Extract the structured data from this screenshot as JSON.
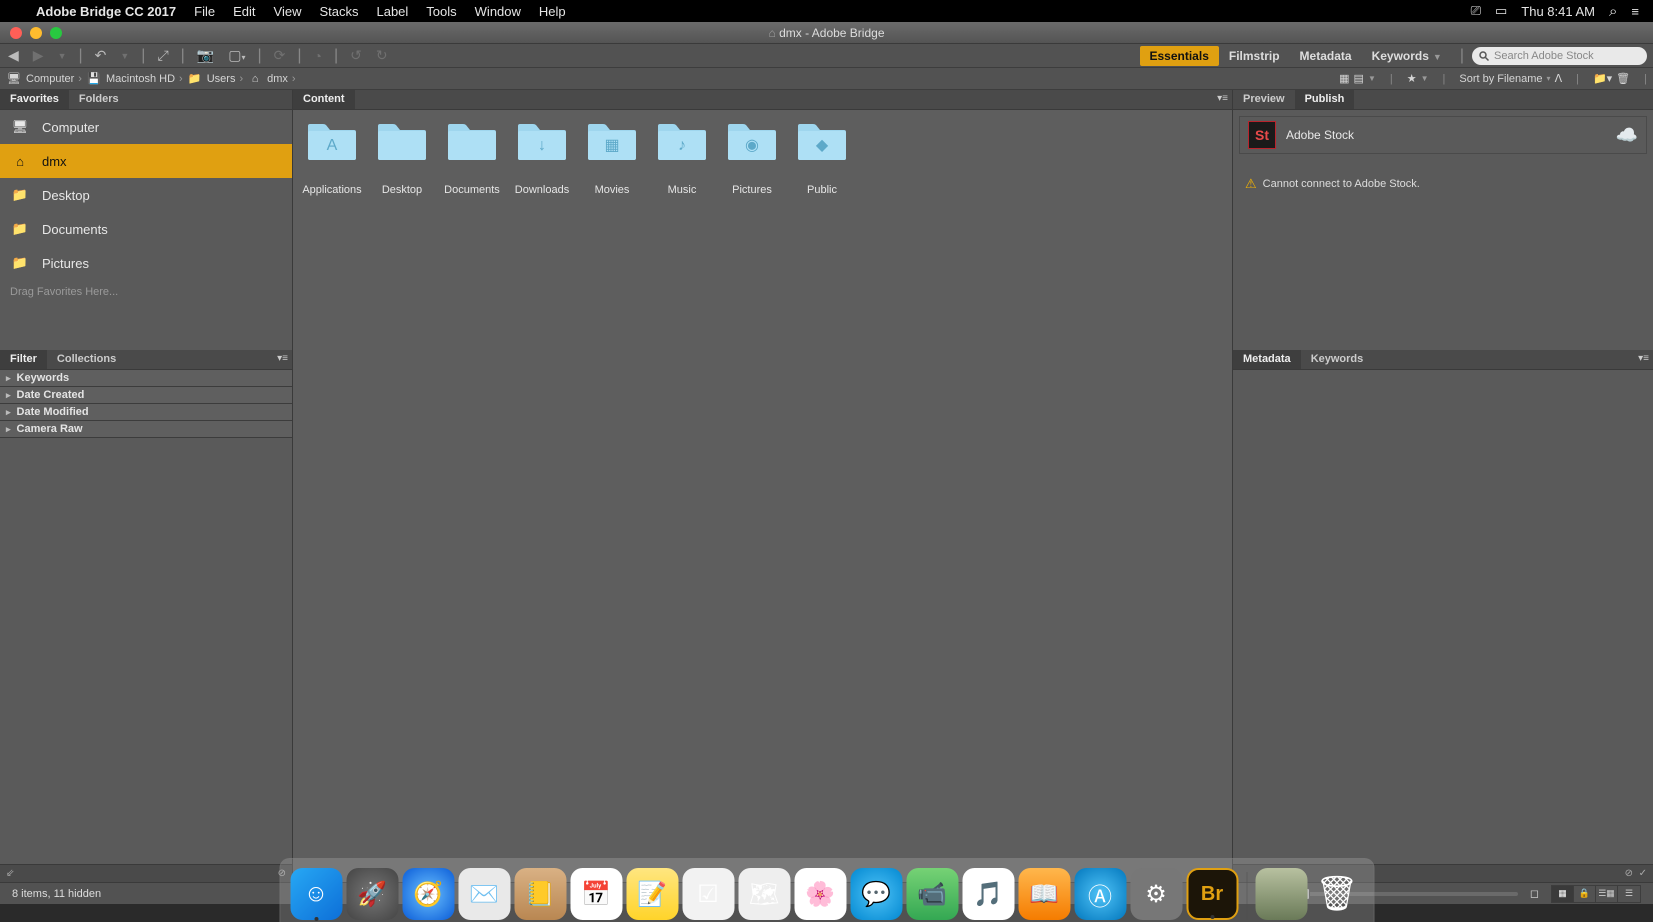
{
  "menubar": {
    "app_name": "Adobe Bridge CC 2017",
    "items": [
      "File",
      "Edit",
      "View",
      "Stacks",
      "Label",
      "Tools",
      "Window",
      "Help"
    ],
    "clock": "Thu 8:41 AM"
  },
  "window": {
    "title": "dmx - Adobe Bridge"
  },
  "workspaces": {
    "items": [
      "Essentials",
      "Filmstrip",
      "Metadata",
      "Keywords"
    ],
    "active": 0
  },
  "search": {
    "placeholder": "Search Adobe Stock"
  },
  "breadcrumbs": [
    {
      "label": "Computer",
      "icon": "monitor"
    },
    {
      "label": "Macintosh HD",
      "icon": "drive"
    },
    {
      "label": "Users",
      "icon": "folder"
    },
    {
      "label": "dmx",
      "icon": "home"
    }
  ],
  "sort": {
    "label": "Sort by Filename",
    "asc": true
  },
  "left": {
    "tabs_top": {
      "items": [
        "Favorites",
        "Folders"
      ],
      "active": 0
    },
    "favorites": [
      {
        "label": "Computer",
        "icon": "monitor",
        "selected": false
      },
      {
        "label": "dmx",
        "icon": "home",
        "selected": true
      },
      {
        "label": "Desktop",
        "icon": "folder",
        "selected": false
      },
      {
        "label": "Documents",
        "icon": "folder",
        "selected": false
      },
      {
        "label": "Pictures",
        "icon": "folder",
        "selected": false
      }
    ],
    "drag_hint": "Drag Favorites Here...",
    "tabs_bottom": {
      "items": [
        "Filter",
        "Collections"
      ],
      "active": 0
    },
    "filters": [
      "Keywords",
      "Date Created",
      "Date Modified",
      "Camera Raw"
    ]
  },
  "content": {
    "tab": "Content",
    "folders": [
      {
        "label": "Applications",
        "glyph": "A"
      },
      {
        "label": "Desktop",
        "glyph": ""
      },
      {
        "label": "Documents",
        "glyph": ""
      },
      {
        "label": "Downloads",
        "glyph": "↓"
      },
      {
        "label": "Movies",
        "glyph": "▦"
      },
      {
        "label": "Music",
        "glyph": "♪"
      },
      {
        "label": "Pictures",
        "glyph": "◉"
      },
      {
        "label": "Public",
        "glyph": "◆"
      }
    ]
  },
  "right": {
    "tabs_top": {
      "items": [
        "Preview",
        "Publish"
      ],
      "active": 1
    },
    "stock_label": "Adobe Stock",
    "stock_error": "Cannot connect to Adobe Stock.",
    "tabs_bottom": {
      "items": [
        "Metadata",
        "Keywords"
      ],
      "active": 0
    }
  },
  "status": {
    "text": "8 items, 11 hidden"
  },
  "dock": {
    "apps": [
      {
        "name": "finder",
        "bg": "linear-gradient(135deg,#27a8f4,#0d6fd8)",
        "glyph": "☺",
        "dot": true
      },
      {
        "name": "launchpad",
        "bg": "radial-gradient(circle,#777,#444)",
        "glyph": "🚀"
      },
      {
        "name": "safari",
        "bg": "radial-gradient(circle,#6cc2ff,#0a5cd8)",
        "glyph": "🧭"
      },
      {
        "name": "mail",
        "bg": "#e9e9e9",
        "glyph": "✉️"
      },
      {
        "name": "contacts",
        "bg": "linear-gradient(#d9b184,#b98752)",
        "glyph": "📒"
      },
      {
        "name": "calendar",
        "bg": "#fff",
        "glyph": "📅"
      },
      {
        "name": "notes",
        "bg": "linear-gradient(#ffe680,#ffd42a)",
        "glyph": "📝"
      },
      {
        "name": "reminders",
        "bg": "#f2f2f2",
        "glyph": "☑"
      },
      {
        "name": "maps",
        "bg": "#eee",
        "glyph": "🗺"
      },
      {
        "name": "photos",
        "bg": "#fff",
        "glyph": "🌸"
      },
      {
        "name": "messages",
        "bg": "radial-gradient(circle,#4fc3f7,#0288d1)",
        "glyph": "💬"
      },
      {
        "name": "facetime",
        "bg": "linear-gradient(#76d275,#34a853)",
        "glyph": "📹"
      },
      {
        "name": "itunes",
        "bg": "#fff",
        "glyph": "🎵"
      },
      {
        "name": "ibooks",
        "bg": "linear-gradient(#ffb74d,#f57c00)",
        "glyph": "📖"
      },
      {
        "name": "appstore",
        "bg": "radial-gradient(circle,#4fc3f7,#0277bd)",
        "glyph": "Ⓐ"
      },
      {
        "name": "preferences",
        "bg": "#777",
        "glyph": "⚙"
      },
      {
        "name": "bridge",
        "bg": "#1c1508",
        "glyph": "Br",
        "dot": true,
        "accent": "#e0a011"
      }
    ],
    "right": [
      {
        "name": "desktop-preview",
        "bg": "linear-gradient(#b8c1a0,#6a7a58)",
        "glyph": ""
      },
      {
        "name": "trash",
        "bg": "transparent",
        "glyph": "🗑"
      }
    ]
  }
}
